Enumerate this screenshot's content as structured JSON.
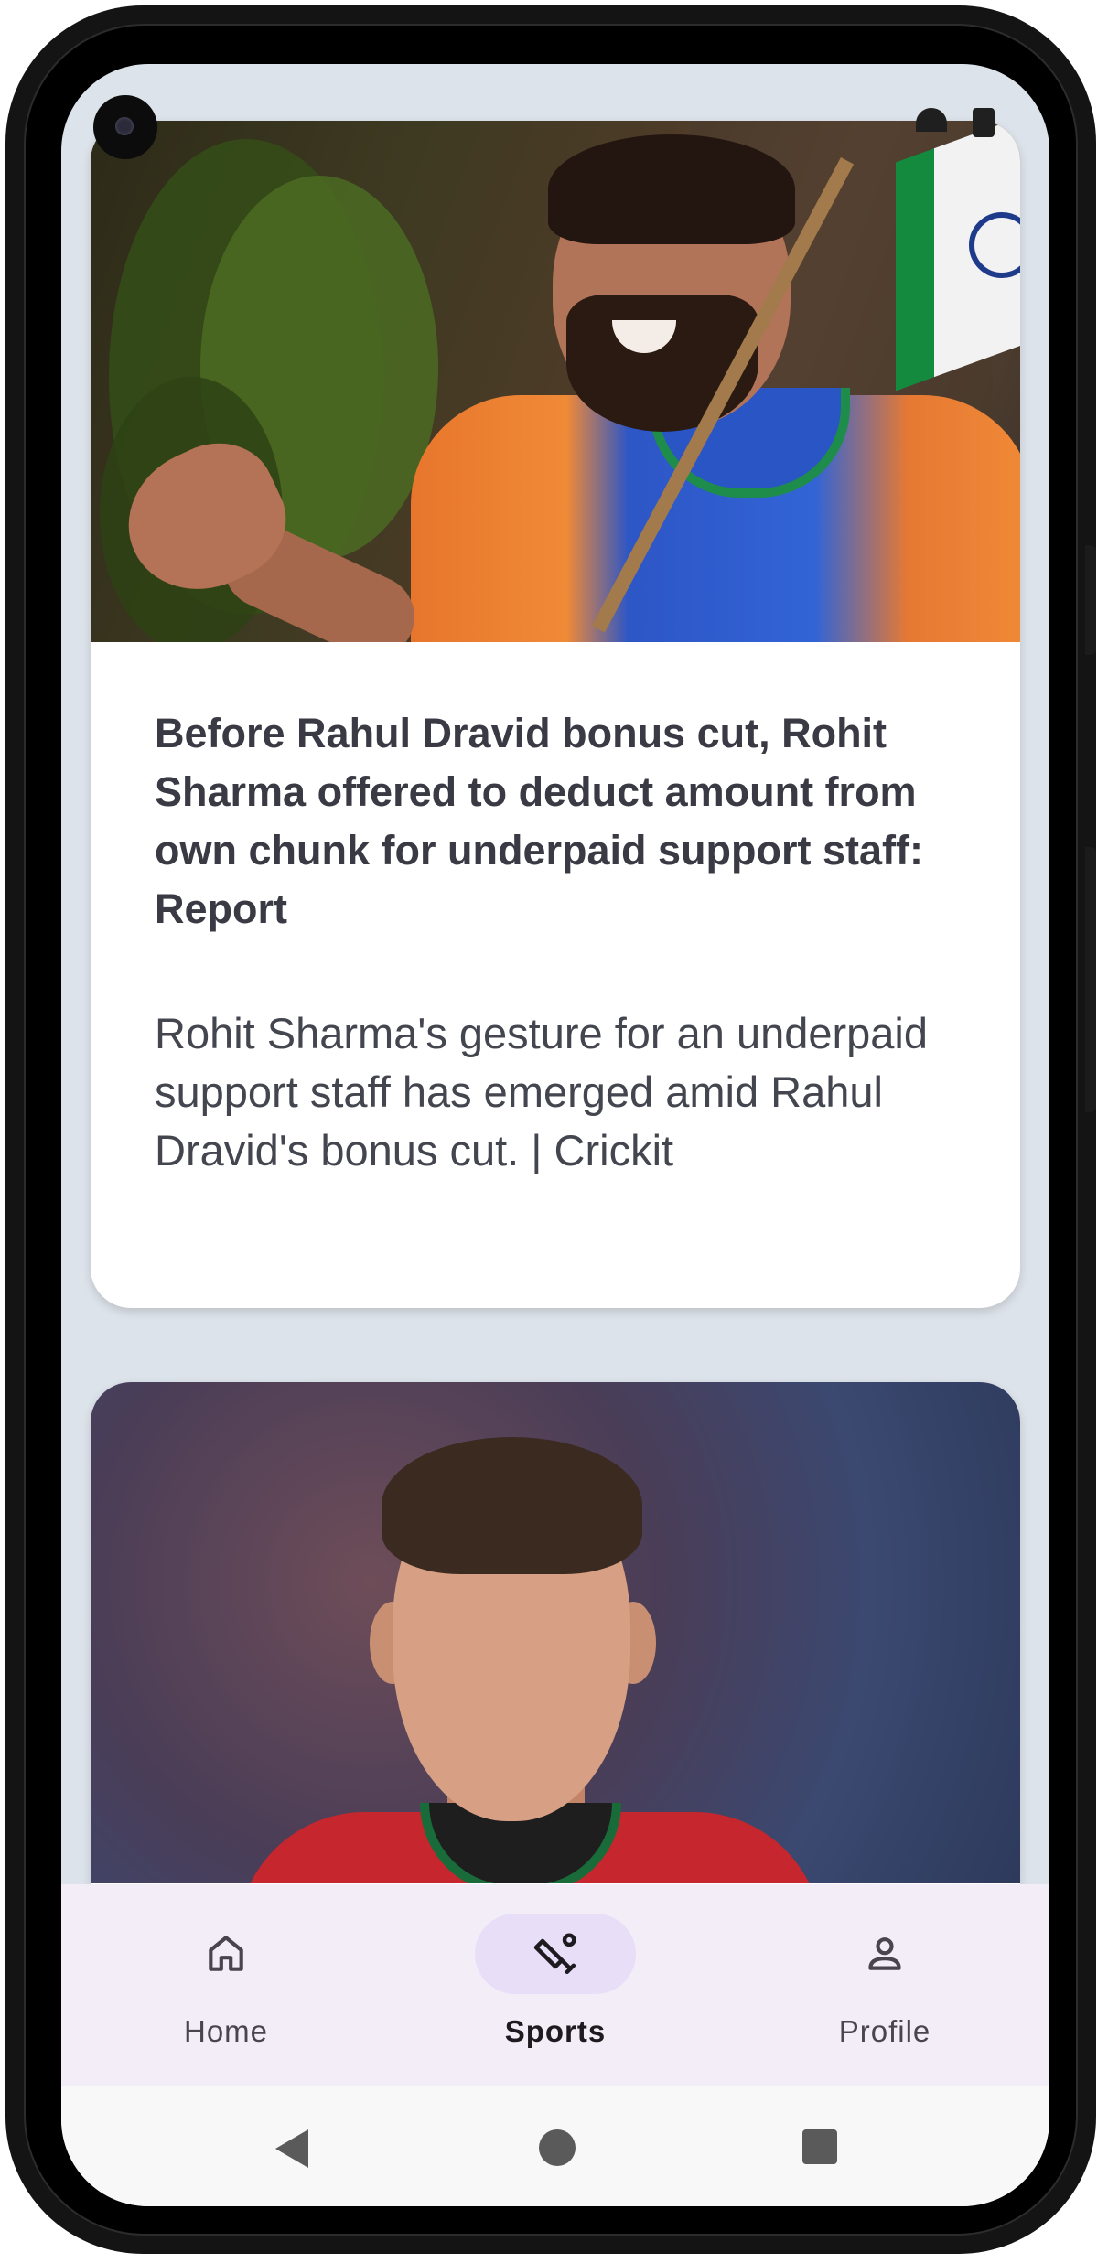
{
  "articles": [
    {
      "headline": "Before Rahul Dravid bonus cut, Rohit Sharma offered to deduct amount from own chunk for underpaid support staff: Report",
      "summary": "Rohit Sharma's gesture for an underpaid support staff has emerged amid Rahul Dravid's bonus cut. | Crickit",
      "image_icon": "cricket-player-photo"
    },
    {
      "image_icon": "football-player-photo"
    }
  ],
  "bottom_nav": {
    "items": [
      {
        "label": "Home",
        "icon": "home-icon",
        "active": false
      },
      {
        "label": "Sports",
        "icon": "sports-cricket-icon",
        "active": true
      },
      {
        "label": "Profile",
        "icon": "profile-icon",
        "active": false
      }
    ],
    "active_indicator_color": "#e8def8",
    "background_color": "#f3edf7"
  },
  "system_nav": {
    "buttons": [
      "back-icon",
      "home-circle-icon",
      "recents-square-icon"
    ]
  }
}
